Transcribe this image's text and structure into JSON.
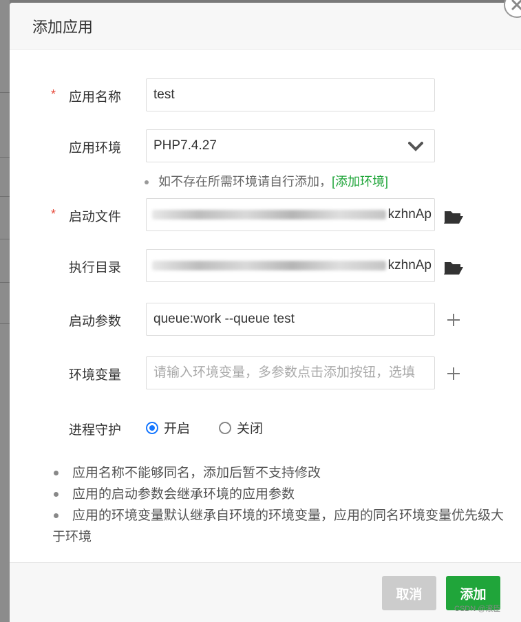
{
  "dialog": {
    "title": "添加应用",
    "close_icon": "close-icon"
  },
  "form": {
    "app_name": {
      "label": "应用名称",
      "required_mark": "*",
      "value": "test"
    },
    "app_env": {
      "label": "应用环境",
      "value": "PHP7.4.27",
      "hint": "如不存在所需环境请自行添加，",
      "hint_link": "[添加环境]"
    },
    "start_file": {
      "label": "启动文件",
      "required_mark": "*",
      "value_tail": "kzhnAp",
      "icon": "folder-open-icon"
    },
    "exec_dir": {
      "label": "执行目录",
      "value_tail": "kzhnAp",
      "icon": "folder-open-icon"
    },
    "start_params": {
      "label": "启动参数",
      "value": "queue:work --queue test",
      "icon": "plus-icon"
    },
    "env_vars": {
      "label": "环境变量",
      "placeholder": "请输入环境变量，多参数点击添加按钮，选填",
      "icon": "plus-icon"
    },
    "daemon": {
      "label": "进程守护",
      "options": [
        {
          "label": "开启",
          "checked": true
        },
        {
          "label": "关闭",
          "checked": false
        }
      ]
    }
  },
  "notes": [
    "应用名称不能够同名，添加后暂不支持修改",
    "应用的启动参数会继承环境的应用参数",
    "应用的环境变量默认继承自环境的环境变量，应用的同名环境变量优先级大于环境"
  ],
  "footer": {
    "cancel_label": "取消",
    "add_label": "添加"
  },
  "watermark": "CSDN @滚臣",
  "colors": {
    "accent_green": "#20a53a",
    "radio_blue": "#1677ff",
    "required_red": "#e64a3b",
    "cancel_gray": "#cccccc"
  }
}
